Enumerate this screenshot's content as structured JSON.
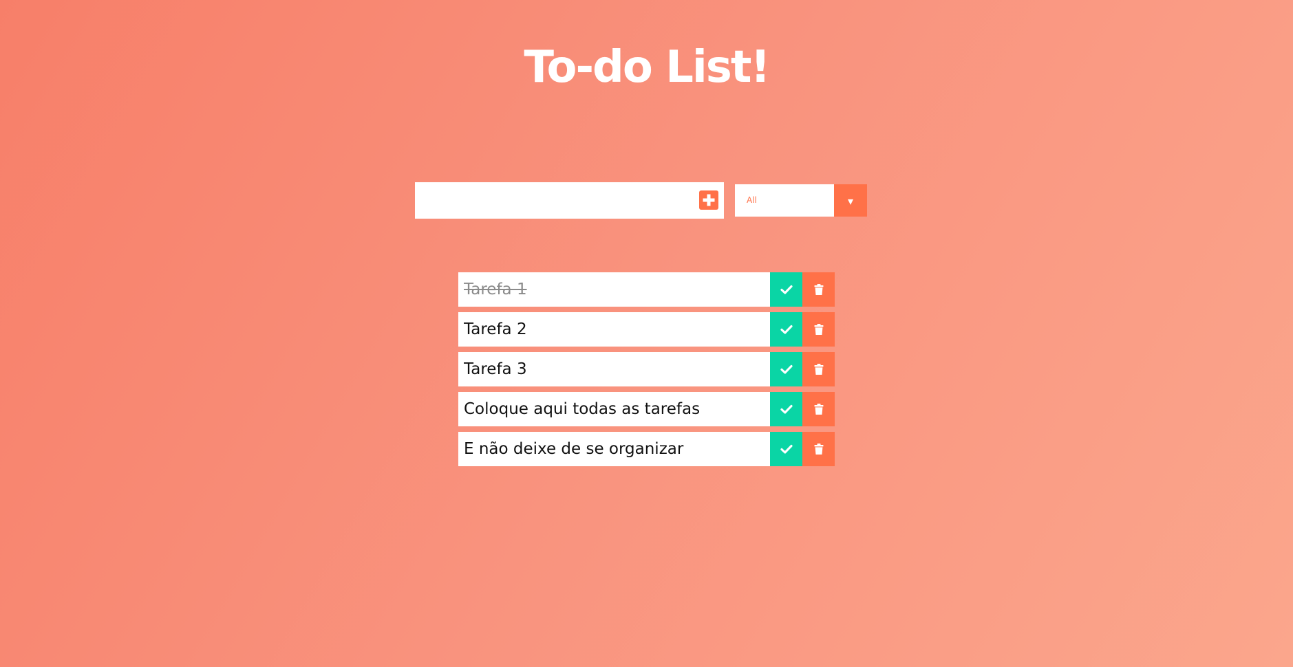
{
  "app": {
    "title": "To-do List!"
  },
  "form": {
    "input_value": "",
    "input_placeholder": "",
    "add_icon": "plus-square-icon"
  },
  "filter": {
    "selected": "All",
    "arrow_glyph": "▾",
    "arrow_icon": "caret-down-icon"
  },
  "todos": [
    {
      "text": "Tarefa 1",
      "completed": true
    },
    {
      "text": "Tarefa 2",
      "completed": false
    },
    {
      "text": "Tarefa 3",
      "completed": false
    },
    {
      "text": "Coloque aqui todas as tarefas",
      "completed": false
    },
    {
      "text": "E não deixe de se organizar",
      "completed": false
    }
  ],
  "item_icons": {
    "complete": "check-icon",
    "delete": "trash-icon"
  },
  "colors": {
    "accent": "#ff7148",
    "complete": "#0ad5a5",
    "title": "#ffffff",
    "filter_text": "#ff7148"
  }
}
